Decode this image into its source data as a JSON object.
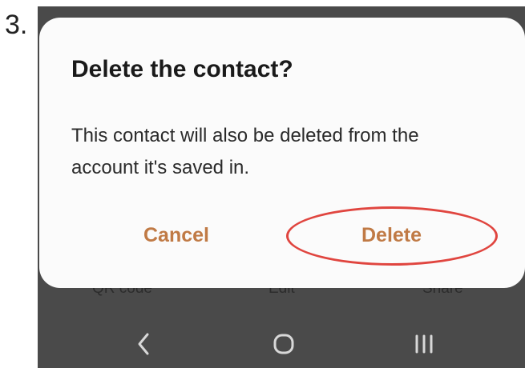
{
  "step": {
    "number": "3."
  },
  "dialog": {
    "title": "Delete the contact?",
    "message": "This contact will also be deleted from the account it's saved in.",
    "cancel_label": "Cancel",
    "delete_label": "Delete",
    "button_color": "#c07a45",
    "highlight_color": "#e0453f"
  },
  "background_actions": {
    "items": [
      {
        "label": "QR code"
      },
      {
        "label": "Edit"
      },
      {
        "label": "Share"
      }
    ]
  },
  "nav_bar": {
    "icons": [
      "back-icon",
      "home-icon",
      "recents-icon"
    ]
  }
}
